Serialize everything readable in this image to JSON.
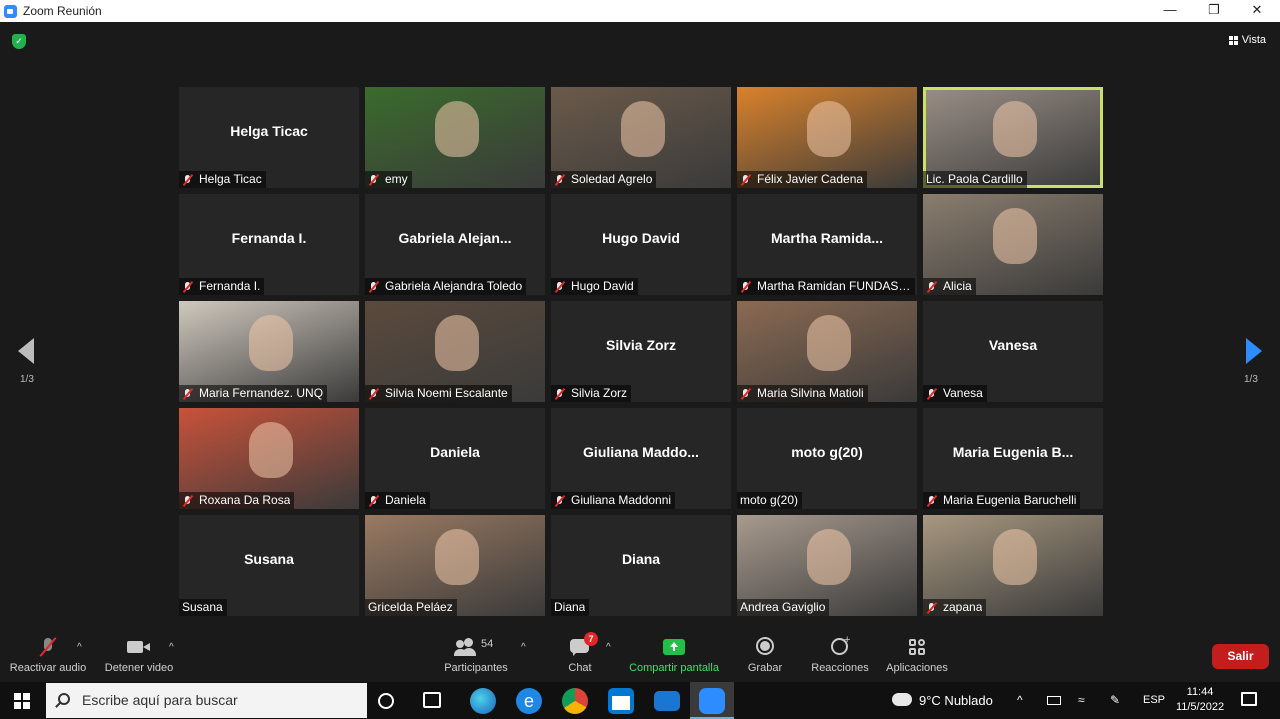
{
  "window": {
    "title": "Zoom Reunión"
  },
  "header": {
    "view_label": "Vista"
  },
  "pagination": {
    "left": "1/3",
    "right": "1/3"
  },
  "tiles": [
    {
      "center": "Helga Ticac",
      "label": "Helga Ticac",
      "muted": true,
      "video": false
    },
    {
      "center": "",
      "label": "emy",
      "muted": true,
      "video": true,
      "bg": "#3a6b2c"
    },
    {
      "center": "",
      "label": "Soledad Agrelo",
      "muted": true,
      "video": true,
      "bg": "#6b5a4a"
    },
    {
      "center": "",
      "label": "Félix Javier Cadena",
      "muted": true,
      "video": true,
      "bg": "#d9822b"
    },
    {
      "center": "",
      "label": "Lic. Paola Cardillo",
      "muted": false,
      "video": true,
      "bg": "#9a8f86",
      "active": true
    },
    {
      "center": "Fernanda I.",
      "label": "Fernanda I.",
      "muted": true,
      "video": false
    },
    {
      "center": "Gabriela  Alejan...",
      "label": "Gabriela Alejandra Toledo",
      "muted": true,
      "video": false
    },
    {
      "center": "Hugo David",
      "label": "Hugo David",
      "muted": true,
      "video": false
    },
    {
      "center": "Martha  Ramida...",
      "label": "Martha Ramidan FUNDAS ...",
      "muted": true,
      "video": false
    },
    {
      "center": "",
      "label": "Alicia",
      "muted": true,
      "video": true,
      "bg": "#8a7d6e"
    },
    {
      "center": "",
      "label": "Maria Fernandez. UNQ",
      "muted": true,
      "video": true,
      "bg": "#cfc8bd"
    },
    {
      "center": "",
      "label": "Silvia Noemi Escalante",
      "muted": true,
      "video": true,
      "bg": "#5b4a3c"
    },
    {
      "center": "Silvia Zorz",
      "label": "Silvia Zorz",
      "muted": true,
      "video": false
    },
    {
      "center": "",
      "label": "Maria Silvina Matioli",
      "muted": true,
      "video": true,
      "bg": "#8b6a52"
    },
    {
      "center": "Vanesa",
      "label": "Vanesa",
      "muted": true,
      "video": false
    },
    {
      "center": "",
      "label": "Roxana Da Rosa",
      "muted": true,
      "video": true,
      "bg": "#c8523a"
    },
    {
      "center": "Daniela",
      "label": "Daniela",
      "muted": true,
      "video": false
    },
    {
      "center": "Giuliana  Maddo...",
      "label": "Giuliana Maddonni",
      "muted": true,
      "video": false
    },
    {
      "center": "moto g(20)",
      "label": "moto g(20)",
      "muted": false,
      "video": false
    },
    {
      "center": "Maria  Eugenia  B...",
      "label": "Maria Eugenia Baruchelli",
      "muted": true,
      "video": false
    },
    {
      "center": "Susana",
      "label": "Susana",
      "muted": false,
      "video": false
    },
    {
      "center": "",
      "label": "Gricelda Peláez",
      "muted": false,
      "video": true,
      "bg": "#9a7a62"
    },
    {
      "center": "Diana",
      "label": "Diana",
      "muted": false,
      "video": false
    },
    {
      "center": "",
      "label": "Andrea Gaviglio",
      "muted": false,
      "video": true,
      "bg": "#a89a8e"
    },
    {
      "center": "",
      "label": "zapana",
      "muted": true,
      "video": true,
      "bg": "#a89880"
    }
  ],
  "toolbar": {
    "audio": "Reactivar audio",
    "video": "Detener video",
    "participants": "Participantes",
    "participants_count": "54",
    "chat": "Chat",
    "chat_badge": "7",
    "share": "Compartir pantalla",
    "record": "Grabar",
    "reactions": "Reacciones",
    "apps": "Aplicaciones",
    "leave": "Salir"
  },
  "taskbar": {
    "search_placeholder": "Escribe aquí para buscar",
    "weather": "9°C  Nublado",
    "lang": "ESP",
    "time": "11:44",
    "date": "11/5/2022"
  }
}
